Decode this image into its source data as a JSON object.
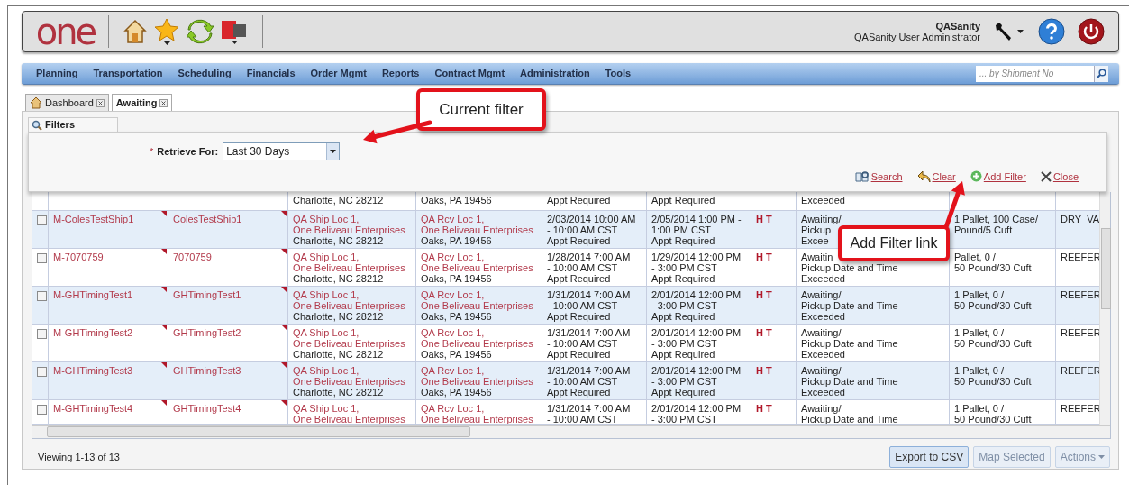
{
  "header": {
    "logo": "one",
    "user_name": "QASanity",
    "user_role": "QASanity User Administrator"
  },
  "menu": [
    "Planning",
    "Transportation",
    "Scheduling",
    "Financials",
    "Order Mgmt",
    "Reports",
    "Contract Mgmt",
    "Administration",
    "Tools"
  ],
  "search": {
    "placeholder": "... by Shipment No"
  },
  "tabs": [
    {
      "label": "Dashboard",
      "selected": false,
      "kind": "home"
    },
    {
      "label": "Awaiting",
      "selected": true,
      "kind": "plain"
    }
  ],
  "filters": {
    "title": "Filters",
    "required_mark": "*",
    "label": "Retrieve For:",
    "value": "Last 30 Days",
    "actions": [
      {
        "label": "Search",
        "kind": "search"
      },
      {
        "label": "Clear",
        "kind": "clear"
      },
      {
        "label": "Add Filter",
        "kind": "add"
      },
      {
        "label": "Close",
        "kind": "close"
      }
    ]
  },
  "grid": {
    "rows": [
      {
        "origin": {
          "city": "Charlotte, NC 28212"
        },
        "destination": {
          "city": "Oaks, PA 19456"
        },
        "pickup": [
          "Appt Required"
        ],
        "delivery": [
          "Appt Required"
        ],
        "status": [
          "Exceeded"
        ]
      },
      {
        "checked": false,
        "shipment": "M-ColesTestShip1",
        "reference": "ColesTestShip1",
        "origin": {
          "name": [
            "QA Ship Loc 1,",
            "One Beliveau Enterprises"
          ],
          "city": "Charlotte, NC 28212"
        },
        "destination": {
          "name": [
            "QA Rcv Loc 1,",
            "One Beliveau Enterprises"
          ],
          "city": "Oaks, PA 19456"
        },
        "pickup": [
          "2/03/2014 10:00 AM",
          "- 10:00 AM CST",
          "Appt Required"
        ],
        "delivery": [
          "2/05/2014 1:00 PM -",
          "1:00 PM CST",
          "Appt Required"
        ],
        "flags": "H T",
        "status": [
          "Awaiting/",
          "Pickup",
          "Excee"
        ],
        "quantity": [
          "1 Pallet, 100 Case/",
          "Pound/5 Cuft"
        ],
        "equipment": "DRY_VA"
      },
      {
        "checked": false,
        "shipment": "M-7070759",
        "reference": "7070759",
        "origin": {
          "name": [
            "QA Ship Loc 1,",
            "One Beliveau Enterprises"
          ],
          "city": "Charlotte, NC 28212"
        },
        "destination": {
          "name": [
            "QA Rcv Loc 1,",
            "One Beliveau Enterprises"
          ],
          "city": "Oaks, PA 19456"
        },
        "pickup": [
          "1/28/2014 7:00 AM",
          "- 10:00 AM CST",
          "Appt Required"
        ],
        "delivery": [
          "1/29/2014 12:00 PM",
          "- 3:00 PM CST",
          "Appt Required"
        ],
        "flags": "H T",
        "status": [
          "Awaitin",
          "Pickup Date and Time",
          "Exceeded"
        ],
        "quantity": [
          "Pallet, 0 /",
          "50 Pound/30 Cuft"
        ],
        "equipment": "REEFER"
      },
      {
        "checked": false,
        "shipment": "M-GHTimingTest1",
        "reference": "GHTimingTest1",
        "origin": {
          "name": [
            "QA Ship Loc 1,",
            "One Beliveau Enterprises"
          ],
          "city": "Charlotte, NC 28212"
        },
        "destination": {
          "name": [
            "QA Rcv Loc 1,",
            "One Beliveau Enterprises"
          ],
          "city": "Oaks, PA 19456"
        },
        "pickup": [
          "1/31/2014 7:00 AM",
          "- 10:00 AM CST",
          "Appt Required"
        ],
        "delivery": [
          "2/01/2014 12:00 PM",
          "- 3:00 PM CST",
          "Appt Required"
        ],
        "flags": "H T",
        "status": [
          "Awaiting/",
          "Pickup Date and Time",
          "Exceeded"
        ],
        "quantity": [
          "1 Pallet, 0 /",
          "50 Pound/30 Cuft"
        ],
        "equipment": "REEFER"
      },
      {
        "checked": false,
        "shipment": "M-GHTimingTest2",
        "reference": "GHTimingTest2",
        "origin": {
          "name": [
            "QA Ship Loc 1,",
            "One Beliveau Enterprises"
          ],
          "city": "Charlotte, NC 28212"
        },
        "destination": {
          "name": [
            "QA Rcv Loc 1,",
            "One Beliveau Enterprises"
          ],
          "city": "Oaks, PA 19456"
        },
        "pickup": [
          "1/31/2014 7:00 AM",
          "- 10:00 AM CST",
          "Appt Required"
        ],
        "delivery": [
          "2/01/2014 12:00 PM",
          "- 3:00 PM CST",
          "Appt Required"
        ],
        "flags": "H T",
        "status": [
          "Awaiting/",
          "Pickup Date and Time",
          "Exceeded"
        ],
        "quantity": [
          "1 Pallet, 0 /",
          "50 Pound/30 Cuft"
        ],
        "equipment": "REEFER"
      },
      {
        "checked": false,
        "shipment": "M-GHTimingTest3",
        "reference": "GHTimingTest3",
        "origin": {
          "name": [
            "QA Ship Loc 1,",
            "One Beliveau Enterprises"
          ],
          "city": "Charlotte, NC 28212"
        },
        "destination": {
          "name": [
            "QA Rcv Loc 1,",
            "One Beliveau Enterprises"
          ],
          "city": "Oaks, PA 19456"
        },
        "pickup": [
          "1/31/2014 7:00 AM",
          "- 10:00 AM CST",
          "Appt Required"
        ],
        "delivery": [
          "2/01/2014 12:00 PM",
          "- 3:00 PM CST",
          "Appt Required"
        ],
        "flags": "H T",
        "status": [
          "Awaiting/",
          "Pickup Date and Time",
          "Exceeded"
        ],
        "quantity": [
          "1 Pallet, 0 /",
          "50 Pound/30 Cuft"
        ],
        "equipment": "REEFER"
      },
      {
        "checked": false,
        "shipment": "M-GHTimingTest4",
        "reference": "GHTimingTest4",
        "origin": {
          "name": [
            "QA Ship Loc 1,",
            "One Beliveau Enterprises"
          ]
        },
        "destination": {
          "name": [
            "QA Rcv Loc 1,",
            "One Beliveau Enterprises"
          ]
        },
        "pickup": [
          "1/31/2014 7:00 AM",
          "- 10:00 AM CST"
        ],
        "delivery": [
          "2/01/2014 12:00 PM",
          "- 3:00 PM CST"
        ],
        "flags": "H T",
        "status": [
          "Awaiting/",
          "Pickup Date and Time"
        ],
        "quantity": [
          "1 Pallet, 0 /",
          "50 Pound/30 Cuft"
        ],
        "equipment": "REEFER"
      }
    ]
  },
  "footer": {
    "summary": "Viewing 1-13 of 13",
    "buttons": [
      {
        "label": "Export to CSV",
        "disabled": false,
        "kind": "plain"
      },
      {
        "label": "Map Selected",
        "disabled": true,
        "kind": "plain"
      },
      {
        "label": "Actions",
        "disabled": true,
        "kind": "dropdown"
      }
    ]
  },
  "callouts": [
    {
      "text": "Current filter"
    },
    {
      "text": "Add Filter link"
    }
  ]
}
